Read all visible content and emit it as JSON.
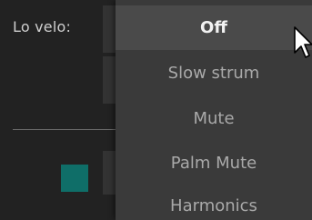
{
  "panel": {
    "label": "Lo velo:"
  },
  "menu": {
    "items": [
      {
        "label": "Off",
        "selected": true
      },
      {
        "label": "Slow strum",
        "selected": false
      },
      {
        "label": "Mute",
        "selected": false
      },
      {
        "label": "Palm Mute",
        "selected": false
      },
      {
        "label": "Harmonics",
        "selected": false
      }
    ]
  },
  "colors": {
    "accent_swatch": "#0f6e68",
    "menu_bg": "#3a3a3a",
    "menu_selected_bg": "#4a4a4a"
  },
  "icons": {
    "cursor": "mouse-pointer-icon"
  }
}
